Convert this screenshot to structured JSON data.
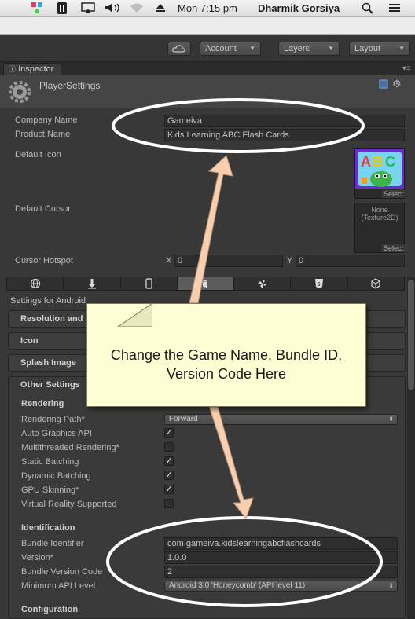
{
  "menubar": {
    "clock": "Mon 7:15 pm",
    "user": "Dharmik Gorsiya",
    "icons": [
      "color-picker-icon",
      "plugin-icon",
      "airplay-icon",
      "volume-icon",
      "wifi-icon",
      "eject-icon",
      "search-icon",
      "list-icon"
    ]
  },
  "toolbar": {
    "cloud_icon": "cloud-icon",
    "account": "Account",
    "layers": "Layers",
    "layout": "Layout"
  },
  "inspector": {
    "tab": "Inspector",
    "title": "PlayerSettings"
  },
  "player": {
    "company_label": "Company Name",
    "company_value": "Gameiva",
    "product_label": "Product Name",
    "product_value": "Kids Learning ABC Flash Cards",
    "default_icon_label": "Default Icon",
    "select": "Select",
    "default_cursor_label": "Default Cursor",
    "cursor_none": "None",
    "cursor_type": "(Texture2D)",
    "hotspot_label": "Cursor Hotspot",
    "hotspot_x_label": "X",
    "hotspot_x": "0",
    "hotspot_y_label": "Y",
    "hotspot_y": "0"
  },
  "platforms": [
    "globe-icon",
    "download-icon",
    "phone-icon",
    "android-icon",
    "pinwheel-icon",
    "html5-icon",
    "box-icon"
  ],
  "settings_for": "Settings for Android",
  "sections": {
    "resolution": "Resolution and Pre",
    "icon": "Icon",
    "splash": "Splash Image",
    "other": "Other Settings"
  },
  "rendering": {
    "header": "Rendering",
    "path_label": "Rendering Path*",
    "path_value": "Forward",
    "auto_graphics": "Auto Graphics API",
    "multithreaded": "Multithreaded Rendering*",
    "static_batching": "Static Batching",
    "dynamic_batching": "Dynamic Batching",
    "gpu_skinning": "GPU Skinning*",
    "vr": "Virtual Reality Supported",
    "checks": {
      "auto_graphics": true,
      "multithreaded": false,
      "static_batching": true,
      "dynamic_batching": true,
      "gpu_skinning": true,
      "vr": false
    }
  },
  "identification": {
    "header": "Identification",
    "bundle_label": "Bundle Identifier",
    "bundle_value": "com.gameiva.kidslearningabcflashcards",
    "version_label": "Version*",
    "version_value": "1.0.0",
    "bundle_code_label": "Bundle Version Code",
    "bundle_code_value": "2",
    "min_api_label": "Minimum API Level",
    "min_api_value": "Android 3.0 'Honeycomb' (API level 11)"
  },
  "configuration": {
    "header": "Configuration"
  },
  "callout": {
    "line1": "Change the Game Name, Bundle ID,",
    "line2": "Version Code Here"
  },
  "colors": {
    "annotation_stroke": "#ffffff",
    "arrow": "#f7cfae",
    "callout_bg": "#fefed4"
  }
}
